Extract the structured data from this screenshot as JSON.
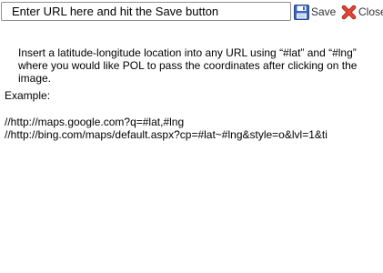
{
  "toolbar": {
    "url_input": {
      "value": "Enter URL here and hit the Save button"
    },
    "save": {
      "label": "Save",
      "icon": "floppy-disk-icon"
    },
    "close": {
      "label": "Close",
      "icon": "red-x-icon"
    }
  },
  "content": {
    "instructions": "Insert a latitude-longitude location into any URL using “#lat” and “#lng” where you would like POL to pass the coordinates after clicking on the image.",
    "example_label": "Example:",
    "examples": [
      "//http://maps.google.com?q=#lat,#lng",
      "//http://bing.com/maps/default.aspx?cp=#lat~#lng&style=o&lvl=1&ti"
    ]
  },
  "colors": {
    "save_icon": "#3a66b5",
    "close_icon": "#d63a2a"
  }
}
